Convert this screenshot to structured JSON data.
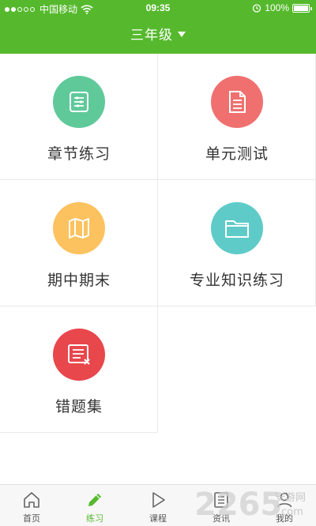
{
  "status_bar": {
    "carrier": "中国移动",
    "time": "09:35",
    "battery": "100%",
    "battery_level": 1.0
  },
  "header": {
    "grade_selector": "三年级",
    "icon": "chevron-down-icon"
  },
  "menu": [
    {
      "label": "章节练习",
      "icon": "list-icon",
      "color": "#5fc99a"
    },
    {
      "label": "单元测试",
      "icon": "document-icon",
      "color": "#f07070"
    },
    {
      "label": "期中期末",
      "icon": "map-icon",
      "color": "#fbc25f"
    },
    {
      "label": "专业知识练习",
      "icon": "folder-icon",
      "color": "#5fcbc8"
    },
    {
      "label": "错题集",
      "icon": "error-notes-icon",
      "color": "#e8474c"
    }
  ],
  "tabbar": [
    {
      "label": "首页",
      "icon": "home-icon",
      "active": false
    },
    {
      "label": "练习",
      "icon": "pencil-icon",
      "active": true
    },
    {
      "label": "课程",
      "icon": "play-icon",
      "active": false
    },
    {
      "label": "资讯",
      "icon": "news-icon",
      "active": false
    },
    {
      "label": "我的",
      "icon": "user-icon",
      "active": false
    }
  ],
  "watermark": {
    "brand": "2265",
    "site": "安游网",
    "domain": ".com"
  },
  "colors": {
    "primary": "#56b92d",
    "text": "#333333",
    "divider": "#e9e9e9"
  }
}
